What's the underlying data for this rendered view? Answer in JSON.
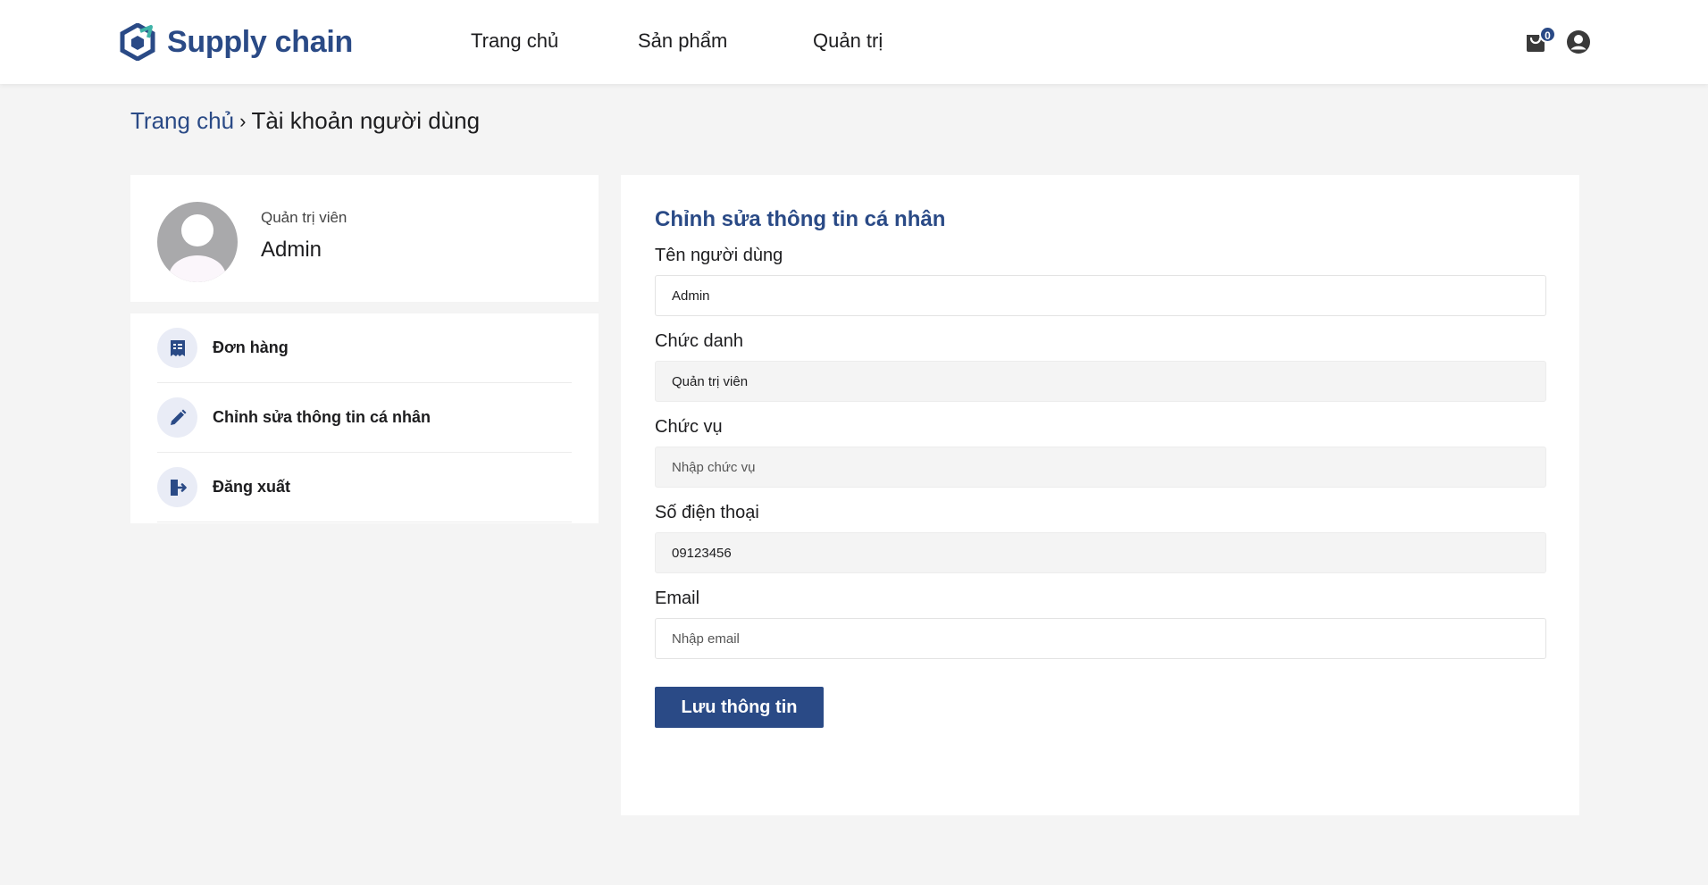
{
  "brand": {
    "name": "Supply chain",
    "color": "#2a4a86",
    "icon": "hexagon-logo-icon"
  },
  "nav": {
    "items": [
      "Trang chủ",
      "Sản phẩm",
      "Quản trị"
    ]
  },
  "header_actions": {
    "cart_count": "0",
    "cart_icon": "cart-icon",
    "user_icon": "user-icon"
  },
  "breadcrumb": {
    "home": "Trang chủ",
    "separator": "›",
    "current": "Tài khoản người dùng"
  },
  "profile": {
    "role": "Quản trị viên",
    "name": "Admin"
  },
  "menu": {
    "items": [
      {
        "label": "Đơn hàng",
        "icon": "receipt-icon"
      },
      {
        "label": "Chỉnh sửa thông tin cá nhân",
        "icon": "pencil-icon"
      },
      {
        "label": "Đăng xuất",
        "icon": "logout-icon"
      }
    ]
  },
  "form": {
    "title": "Chỉnh sửa thông tin cá nhân",
    "fields": [
      {
        "label": "Tên người dùng",
        "value": "Admin",
        "placeholder": ""
      },
      {
        "label": "Chức danh",
        "value": "Quản trị viên",
        "placeholder": ""
      },
      {
        "label": "Chức vụ",
        "value": "",
        "placeholder": "Nhập chức vụ"
      },
      {
        "label": "Số điện thoại",
        "value": "09123456",
        "placeholder": ""
      },
      {
        "label": "Email",
        "value": "",
        "placeholder": "Nhập email"
      }
    ],
    "submit_label": "Lưu thông tin"
  },
  "colors": {
    "primary": "#2a4a86",
    "page_bg": "#f4f4f4",
    "icon_bg": "#e9ecf6"
  }
}
